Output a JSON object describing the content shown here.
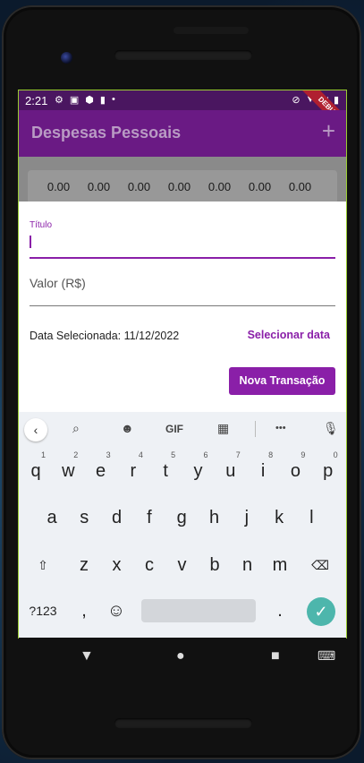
{
  "status_bar": {
    "time": "2:21",
    "left_icons": [
      "gear-icon",
      "a-icon",
      "shield-icon",
      "clipboard-icon",
      "dot-icon"
    ],
    "right_icons": [
      "mute-icon",
      "wifi-icon",
      "signal-icon",
      "battery-icon"
    ],
    "debug_label": "DEBUG"
  },
  "app_bar": {
    "title": "Despesas Pessoais",
    "add_icon": "+"
  },
  "chart": {
    "values": [
      "0.00",
      "0.00",
      "0.00",
      "0.00",
      "0.00",
      "0.00",
      "0.00"
    ]
  },
  "form": {
    "title_label": "Título",
    "title_value": "",
    "value_label": "Valor (R$)",
    "selected_date_text": "Data Selecionada: 11/12/2022",
    "select_date_button": "Selecionar data",
    "submit_button": "Nova Transação"
  },
  "keyboard": {
    "toolbar": {
      "gif_label": "GIF",
      "more_label": "•••"
    },
    "row1": [
      {
        "k": "q",
        "n": "1"
      },
      {
        "k": "w",
        "n": "2"
      },
      {
        "k": "e",
        "n": "3"
      },
      {
        "k": "r",
        "n": "4"
      },
      {
        "k": "t",
        "n": "5"
      },
      {
        "k": "y",
        "n": "6"
      },
      {
        "k": "u",
        "n": "7"
      },
      {
        "k": "i",
        "n": "8"
      },
      {
        "k": "o",
        "n": "9"
      },
      {
        "k": "p",
        "n": "0"
      }
    ],
    "row2": [
      "a",
      "s",
      "d",
      "f",
      "g",
      "h",
      "j",
      "k",
      "l"
    ],
    "row3": [
      "z",
      "x",
      "c",
      "v",
      "b",
      "n",
      "m"
    ],
    "symbols_key": "?123",
    "comma_key": ",",
    "period_key": ".",
    "emoji_key": "☺"
  },
  "nav_bar": {
    "back": "▼",
    "home": "●",
    "recents": "■",
    "keyboard_switch": "⌨"
  }
}
